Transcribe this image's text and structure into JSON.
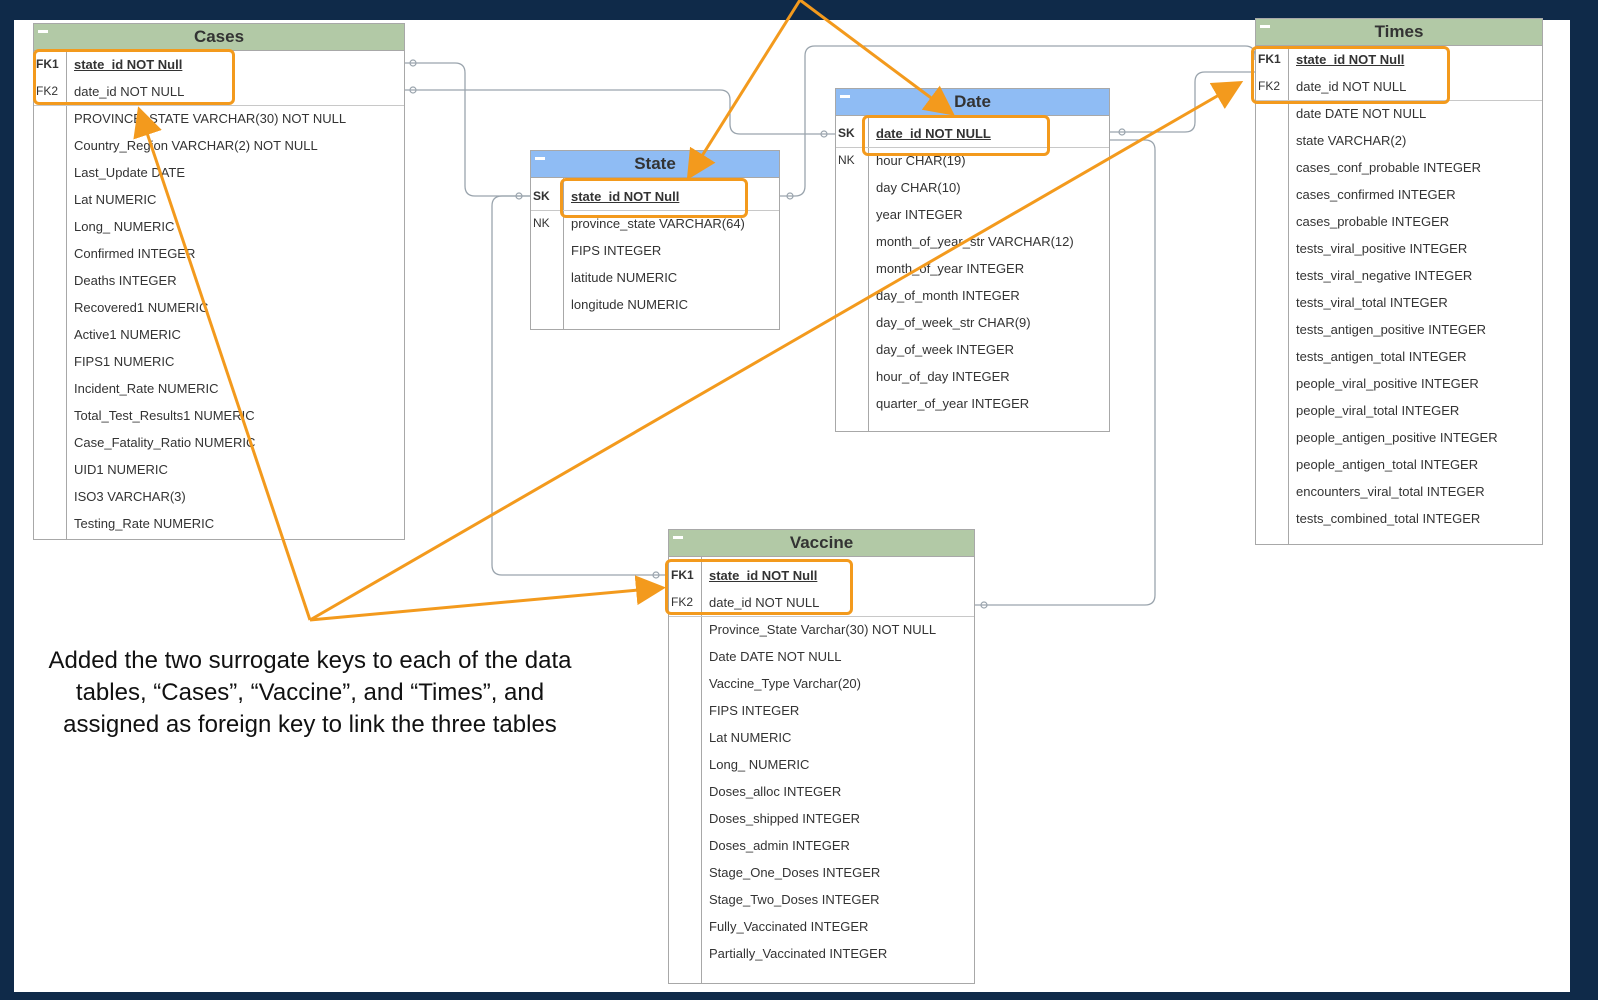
{
  "colors": {
    "frame": "#0f2a49",
    "green_header": "#b2c9a6",
    "blue_header": "#8fbcf4",
    "highlight": "#f39a1d"
  },
  "tables": {
    "cases": {
      "title": "Cases",
      "rows": [
        {
          "tag": "FK1",
          "text": "state_id NOT Null"
        },
        {
          "tag": "FK2",
          "text": "date_id NOT NULL"
        },
        {
          "tag": "",
          "text": "PROVINCE_STATE VARCHAR(30) NOT NULL"
        },
        {
          "tag": "",
          "text": "Country_Region VARCHAR(2) NOT NULL"
        },
        {
          "tag": "",
          "text": "Last_Update DATE"
        },
        {
          "tag": "",
          "text": "Lat NUMERIC"
        },
        {
          "tag": "",
          "text": "Long_ NUMERIC"
        },
        {
          "tag": "",
          "text": "Confirmed INTEGER"
        },
        {
          "tag": "",
          "text": "Deaths INTEGER"
        },
        {
          "tag": "",
          "text": "Recovered1 NUMERIC"
        },
        {
          "tag": "",
          "text": "Active1 NUMERIC"
        },
        {
          "tag": "",
          "text": "FIPS1 NUMERIC"
        },
        {
          "tag": "",
          "text": "Incident_Rate NUMERIC"
        },
        {
          "tag": "",
          "text": "Total_Test_Results1 NUMERIC"
        },
        {
          "tag": "",
          "text": "Case_Fatality_Ratio NUMERIC"
        },
        {
          "tag": "",
          "text": "UID1 NUMERIC"
        },
        {
          "tag": "",
          "text": "ISO3 VARCHAR(3)"
        },
        {
          "tag": "",
          "text": "Testing_Rate NUMERIC"
        }
      ]
    },
    "state": {
      "title": "State",
      "rows": [
        {
          "tag": "SK",
          "text": "state_id NOT Null"
        },
        {
          "tag": "NK",
          "text": "province_state VARCHAR(64)"
        },
        {
          "tag": "",
          "text": "FIPS INTEGER"
        },
        {
          "tag": "",
          "text": "latitude NUMERIC"
        },
        {
          "tag": "",
          "text": "longitude NUMERIC"
        }
      ]
    },
    "date": {
      "title": "Date",
      "rows": [
        {
          "tag": "SK",
          "text": "date_id NOT NULL"
        },
        {
          "tag": "NK",
          "text": "hour CHAR(19)"
        },
        {
          "tag": "",
          "text": "day CHAR(10)"
        },
        {
          "tag": "",
          "text": "year INTEGER"
        },
        {
          "tag": "",
          "text": "month_of_year_str VARCHAR(12)"
        },
        {
          "tag": "",
          "text": "month_of_year INTEGER"
        },
        {
          "tag": "",
          "text": "day_of_month INTEGER"
        },
        {
          "tag": "",
          "text": "day_of_week_str CHAR(9)"
        },
        {
          "tag": "",
          "text": "day_of_week INTEGER"
        },
        {
          "tag": "",
          "text": "hour_of_day INTEGER"
        },
        {
          "tag": "",
          "text": "quarter_of_year INTEGER"
        }
      ]
    },
    "times": {
      "title": "Times",
      "rows": [
        {
          "tag": "FK1",
          "text": "state_id NOT Null"
        },
        {
          "tag": "FK2",
          "text": "date_id NOT NULL"
        },
        {
          "tag": "",
          "text": "date DATE NOT NULL"
        },
        {
          "tag": "",
          "text": "state VARCHAR(2)"
        },
        {
          "tag": "",
          "text": "cases_conf_probable INTEGER"
        },
        {
          "tag": "",
          "text": "cases_confirmed INTEGER"
        },
        {
          "tag": "",
          "text": "cases_probable INTEGER"
        },
        {
          "tag": "",
          "text": "tests_viral_positive INTEGER"
        },
        {
          "tag": "",
          "text": "tests_viral_negative INTEGER"
        },
        {
          "tag": "",
          "text": "tests_viral_total INTEGER"
        },
        {
          "tag": "",
          "text": "tests_antigen_positive INTEGER"
        },
        {
          "tag": "",
          "text": "tests_antigen_total INTEGER"
        },
        {
          "tag": "",
          "text": "people_viral_positive INTEGER"
        },
        {
          "tag": "",
          "text": "people_viral_total INTEGER"
        },
        {
          "tag": "",
          "text": "people_antigen_positive INTEGER"
        },
        {
          "tag": "",
          "text": "people_antigen_total INTEGER"
        },
        {
          "tag": "",
          "text": "encounters_viral_total INTEGER"
        },
        {
          "tag": "",
          "text": "tests_combined_total INTEGER"
        }
      ]
    },
    "vaccine": {
      "title": "Vaccine",
      "rows": [
        {
          "tag": "FK1",
          "text": "state_id NOT Null"
        },
        {
          "tag": "FK2",
          "text": "date_id NOT NULL"
        },
        {
          "tag": "",
          "text": "Province_State Varchar(30) NOT NULL"
        },
        {
          "tag": "",
          "text": "Date DATE NOT NULL"
        },
        {
          "tag": "",
          "text": "Vaccine_Type Varchar(20)"
        },
        {
          "tag": "",
          "text": "FIPS INTEGER"
        },
        {
          "tag": "",
          "text": "Lat NUMERIC"
        },
        {
          "tag": "",
          "text": "Long_ NUMERIC"
        },
        {
          "tag": "",
          "text": "Doses_alloc INTEGER"
        },
        {
          "tag": "",
          "text": "Doses_shipped INTEGER"
        },
        {
          "tag": "",
          "text": "Doses_admin INTEGER"
        },
        {
          "tag": "",
          "text": "Stage_One_Doses INTEGER"
        },
        {
          "tag": "",
          "text": "Stage_Two_Doses INTEGER"
        },
        {
          "tag": "",
          "text": "Fully_Vaccinated INTEGER"
        },
        {
          "tag": "",
          "text": "Partially_Vaccinated INTEGER"
        }
      ]
    }
  },
  "annotation": "Added the two surrogate keys to each of the data tables, “Cases”, “Vaccine”, and “Times”, and assigned as foreign key to link the three tables"
}
